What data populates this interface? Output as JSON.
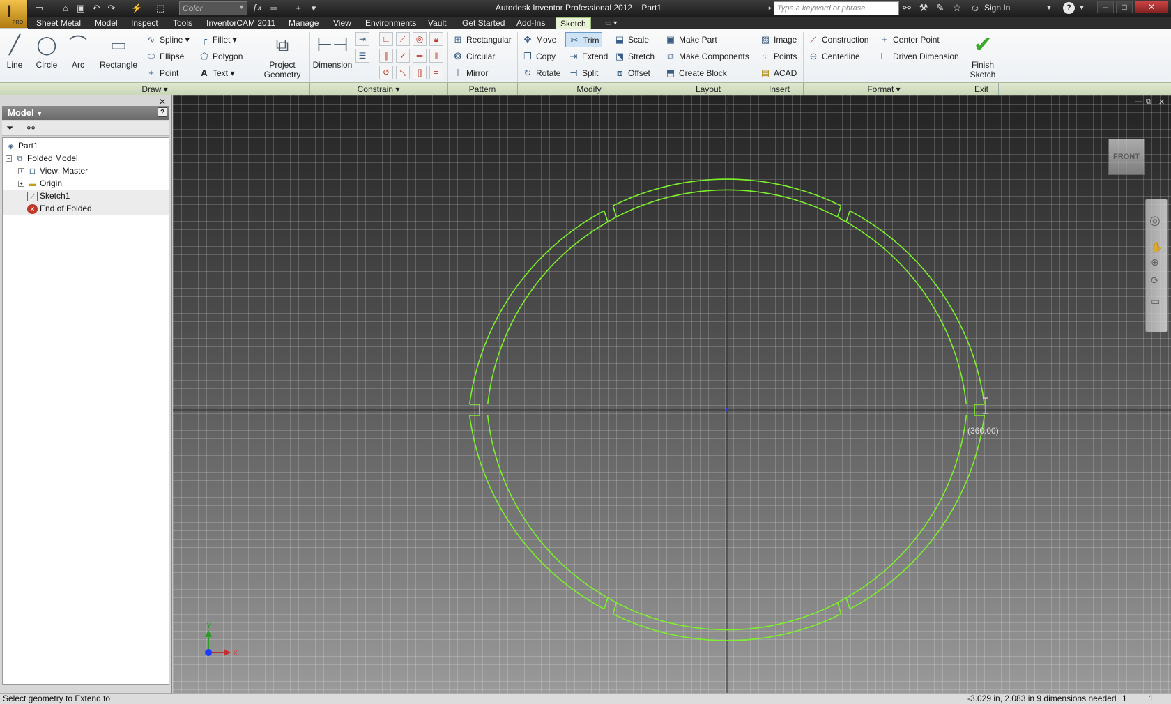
{
  "app": {
    "title": "Autodesk Inventor Professional 2012    Part1",
    "logo_letter": "I",
    "logo_tag": "PRO"
  },
  "quick_access": {
    "color_value": "Color",
    "search_placeholder": "Type a keyword or phrase",
    "sign_in": "Sign In"
  },
  "menu": [
    {
      "label": "Sheet Metal"
    },
    {
      "label": "Model"
    },
    {
      "label": "Inspect"
    },
    {
      "label": "Tools"
    },
    {
      "label": "InventorCAM 2011"
    },
    {
      "label": "Manage"
    },
    {
      "label": "View"
    },
    {
      "label": "Environments"
    },
    {
      "label": "Vault"
    },
    {
      "label": "Get Started"
    },
    {
      "label": "Add-Ins"
    },
    {
      "label": "Sketch"
    }
  ],
  "ribbon": {
    "draw": {
      "line": "Line",
      "circle": "Circle",
      "arc": "Arc",
      "rectangle": "Rectangle",
      "spline": "Spline",
      "ellipse": "Ellipse",
      "point": "Point",
      "fillet": "Fillet",
      "polygon": "Polygon",
      "text": "Text",
      "project_geometry_1": "Project",
      "project_geometry_2": "Geometry"
    },
    "constrain": {
      "dimension": "Dimension"
    },
    "pattern": {
      "rectangular": "Rectangular",
      "circular": "Circular",
      "mirror": "Mirror"
    },
    "modify": {
      "move": "Move",
      "copy": "Copy",
      "rotate": "Rotate",
      "trim": "Trim",
      "extend": "Extend",
      "split": "Split",
      "scale": "Scale",
      "stretch": "Stretch",
      "offset": "Offset"
    },
    "layout": {
      "make_part": "Make Part",
      "make_components": "Make Components",
      "create_block": "Create Block"
    },
    "insert": {
      "image": "Image",
      "points": "Points",
      "acad": "ACAD"
    },
    "format": {
      "construction": "Construction",
      "centerline": "Centerline",
      "center_point": "Center Point",
      "driven_dimension": "Driven Dimension"
    },
    "exit": {
      "finish_1": "Finish",
      "finish_2": "Sketch"
    },
    "panels": {
      "draw": "Draw",
      "constrain": "Constrain",
      "pattern": "Pattern",
      "modify": "Modify",
      "layout": "Layout",
      "insert": "Insert",
      "format": "Format",
      "exit": "Exit"
    }
  },
  "browser": {
    "header": "Model",
    "tree": [
      {
        "label": "Part1"
      },
      {
        "label": "Folded Model"
      },
      {
        "label": "View: Master"
      },
      {
        "label": "Origin"
      },
      {
        "label": "Sketch1"
      },
      {
        "label": "End of Folded"
      }
    ]
  },
  "viewport": {
    "view_cube_label": "FRONT",
    "dimension_label": "(360.00)",
    "axis_x": "X",
    "axis_y": "Y",
    "sketch_color": "#7cf02a"
  },
  "status": {
    "message": "Select geometry to Extend to",
    "coords": "-3.029 in, 2.083 in  9 dimensions needed",
    "n1": "1",
    "n2": "1"
  }
}
